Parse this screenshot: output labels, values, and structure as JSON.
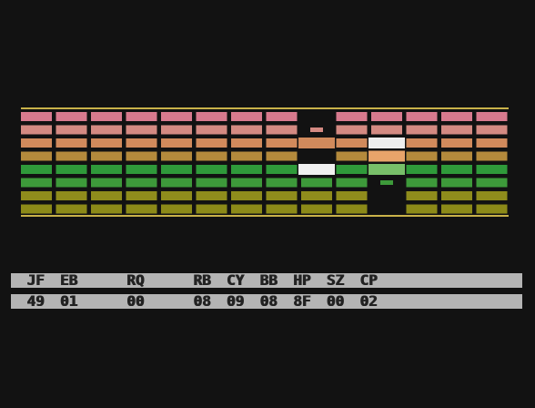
{
  "game": {
    "rows": [
      {
        "color": "#d87a8e",
        "gaps": [
          8
        ],
        "pieces": []
      },
      {
        "color": "#d48a82",
        "gaps": [
          8
        ],
        "pieces": [
          {
            "col": 8,
            "color": "#d48a82",
            "size": "small"
          }
        ]
      },
      {
        "color": "#d18a5c",
        "gaps": [
          8
        ],
        "pieces": [
          {
            "col": 8,
            "color": "#d18a5c",
            "size": "full"
          },
          {
            "col": 10,
            "color": "#eeeeee",
            "size": "full"
          }
        ]
      },
      {
        "color": "#b48a3c",
        "gaps": [
          8
        ],
        "pieces": [
          {
            "col": 10,
            "color": "#e8a46a",
            "size": "full"
          }
        ]
      },
      {
        "color": "#2f9a3a",
        "gaps": [],
        "pieces": [
          {
            "col": 8,
            "color": "#f0f0f0",
            "size": "full"
          },
          {
            "col": 10,
            "color": "#78bf69",
            "size": "full"
          }
        ]
      },
      {
        "color": "#3d9a3a",
        "gaps": [
          10
        ],
        "pieces": [
          {
            "col": 10,
            "color": "#3d9a3a",
            "size": "small"
          }
        ]
      },
      {
        "color": "#8f8c1c",
        "gaps": [
          10
        ],
        "pieces": []
      },
      {
        "color": "#8c8a18",
        "gaps": [
          10
        ],
        "pieces": []
      }
    ],
    "separator_color": "#c9b24a"
  },
  "status": {
    "labels": [
      {
        "text": "JF",
        "col": 1
      },
      {
        "text": "EB",
        "col": 4
      },
      {
        "text": "RQ",
        "col": 10
      },
      {
        "text": "RB",
        "col": 16
      },
      {
        "text": "CY",
        "col": 19
      },
      {
        "text": "BB",
        "col": 22
      },
      {
        "text": "HP",
        "col": 25
      },
      {
        "text": "SZ",
        "col": 28
      },
      {
        "text": "CP",
        "col": 31
      }
    ],
    "values": [
      {
        "text": "49",
        "col": 1
      },
      {
        "text": "01",
        "col": 4
      },
      {
        "text": "00",
        "col": 10
      },
      {
        "text": "08",
        "col": 16
      },
      {
        "text": "09",
        "col": 19
      },
      {
        "text": "08",
        "col": 22
      },
      {
        "text": "8F",
        "col": 25
      },
      {
        "text": "00",
        "col": 28
      },
      {
        "text": "02",
        "col": 31
      }
    ],
    "bar_color": "#b4b4b4",
    "text_color": "#222222"
  }
}
